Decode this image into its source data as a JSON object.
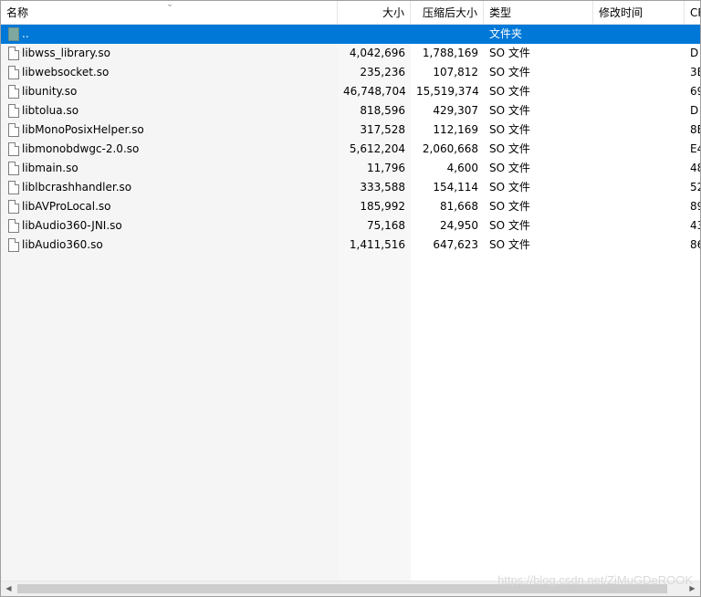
{
  "columns": {
    "name": "名称",
    "size": "大小",
    "packed": "压缩后大小",
    "type": "类型",
    "modified": "修改时间",
    "crc": "CR"
  },
  "sort_indicator": "⌄",
  "parent_row": {
    "name": "..",
    "type": "文件夹"
  },
  "files": [
    {
      "name": "libwss_library.so",
      "size": "4,042,696",
      "packed": "1,788,169",
      "type": "SO 文件",
      "crc": "D"
    },
    {
      "name": "libwebsocket.so",
      "size": "235,236",
      "packed": "107,812",
      "type": "SO 文件",
      "crc": "3E"
    },
    {
      "name": "libunity.so",
      "size": "46,748,704",
      "packed": "15,519,374",
      "type": "SO 文件",
      "crc": "69"
    },
    {
      "name": "libtolua.so",
      "size": "818,596",
      "packed": "429,307",
      "type": "SO 文件",
      "crc": "D"
    },
    {
      "name": "libMonoPosixHelper.so",
      "size": "317,528",
      "packed": "112,169",
      "type": "SO 文件",
      "crc": "8E"
    },
    {
      "name": "libmonobdwgc-2.0.so",
      "size": "5,612,204",
      "packed": "2,060,668",
      "type": "SO 文件",
      "crc": "E4"
    },
    {
      "name": "libmain.so",
      "size": "11,796",
      "packed": "4,600",
      "type": "SO 文件",
      "crc": "48"
    },
    {
      "name": "liblbcrashhandler.so",
      "size": "333,588",
      "packed": "154,114",
      "type": "SO 文件",
      "crc": "52"
    },
    {
      "name": "libAVProLocal.so",
      "size": "185,992",
      "packed": "81,668",
      "type": "SO 文件",
      "crc": "89"
    },
    {
      "name": "libAudio360-JNI.so",
      "size": "75,168",
      "packed": "24,950",
      "type": "SO 文件",
      "crc": "43"
    },
    {
      "name": "libAudio360.so",
      "size": "1,411,516",
      "packed": "647,623",
      "type": "SO 文件",
      "crc": "86"
    }
  ],
  "watermark": "https://blog.csdn.net/ZiMuGDeROOK",
  "colors": {
    "selection": "#0078d7",
    "header_border": "#e5e5e5"
  }
}
